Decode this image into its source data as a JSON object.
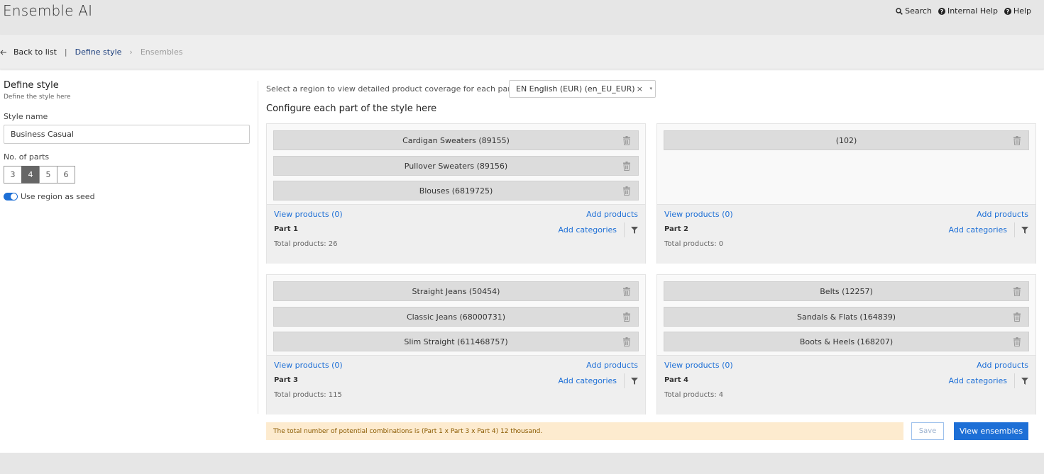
{
  "header": {
    "app_title": "Ensemble AI",
    "links": [
      {
        "label": "Search",
        "icon": "search-icon"
      },
      {
        "label": "Internal Help",
        "icon": "question-circle-icon"
      },
      {
        "label": "Help",
        "icon": "question-circle-icon"
      }
    ]
  },
  "breadcrumb": {
    "back_label": "Back to list",
    "separator": "|",
    "current": "Define style",
    "chevron": "›",
    "next": "Ensembles"
  },
  "left_panel": {
    "title": "Define style",
    "subtitle": "Define the style here",
    "style_name_label": "Style name",
    "style_name_value": "Business Casual",
    "parts_label": "No. of parts",
    "part_options": [
      "3",
      "4",
      "5",
      "6"
    ],
    "selected_parts": "4",
    "toggle_label": "Use region as seed",
    "toggle_on": true
  },
  "region": {
    "label": "Select a region to view detailed product coverage for each part",
    "selected": "EN English (EUR) (en_EU_EUR)",
    "clear": "×",
    "caret": "▾"
  },
  "config_title": "Configure each part of the style here",
  "parts": [
    {
      "categories": [
        "Cardigan Sweaters (89155)",
        "Pullover Sweaters (89156)",
        "Blouses (6819725)"
      ],
      "view_products": "View products (0)",
      "add_products": "Add products",
      "label": "Part 1",
      "add_categories": "Add categories",
      "total": "Total products: 26"
    },
    {
      "categories": [
        "(102)"
      ],
      "view_products": "View products (0)",
      "add_products": "Add products",
      "label": "Part 2",
      "add_categories": "Add categories",
      "total": "Total products: 0"
    },
    {
      "categories": [
        "Straight Jeans (50454)",
        "Classic Jeans (68000731)",
        "Slim Straight (611468757)"
      ],
      "view_products": "View products (0)",
      "add_products": "Add products",
      "label": "Part 3",
      "add_categories": "Add categories",
      "total": "Total products: 115"
    },
    {
      "categories": [
        "Belts (12257)",
        "Sandals & Flats (164839)",
        "Boots & Heels (168207)"
      ],
      "view_products": "View products (0)",
      "add_products": "Add products",
      "label": "Part 4",
      "add_categories": "Add categories",
      "total": "Total products: 4"
    }
  ],
  "footer": {
    "notice": "The total number of potential combinations is (Part 1 x Part 3 x Part 4) 12 thousand.",
    "save_label": "Save",
    "view_ensembles_label": "View ensembles"
  },
  "colors": {
    "accent": "#1d6fd6",
    "header_bg": "#e6e6e6",
    "notice_bg": "#fdebcf",
    "chip_bg": "#dcdcdc"
  }
}
